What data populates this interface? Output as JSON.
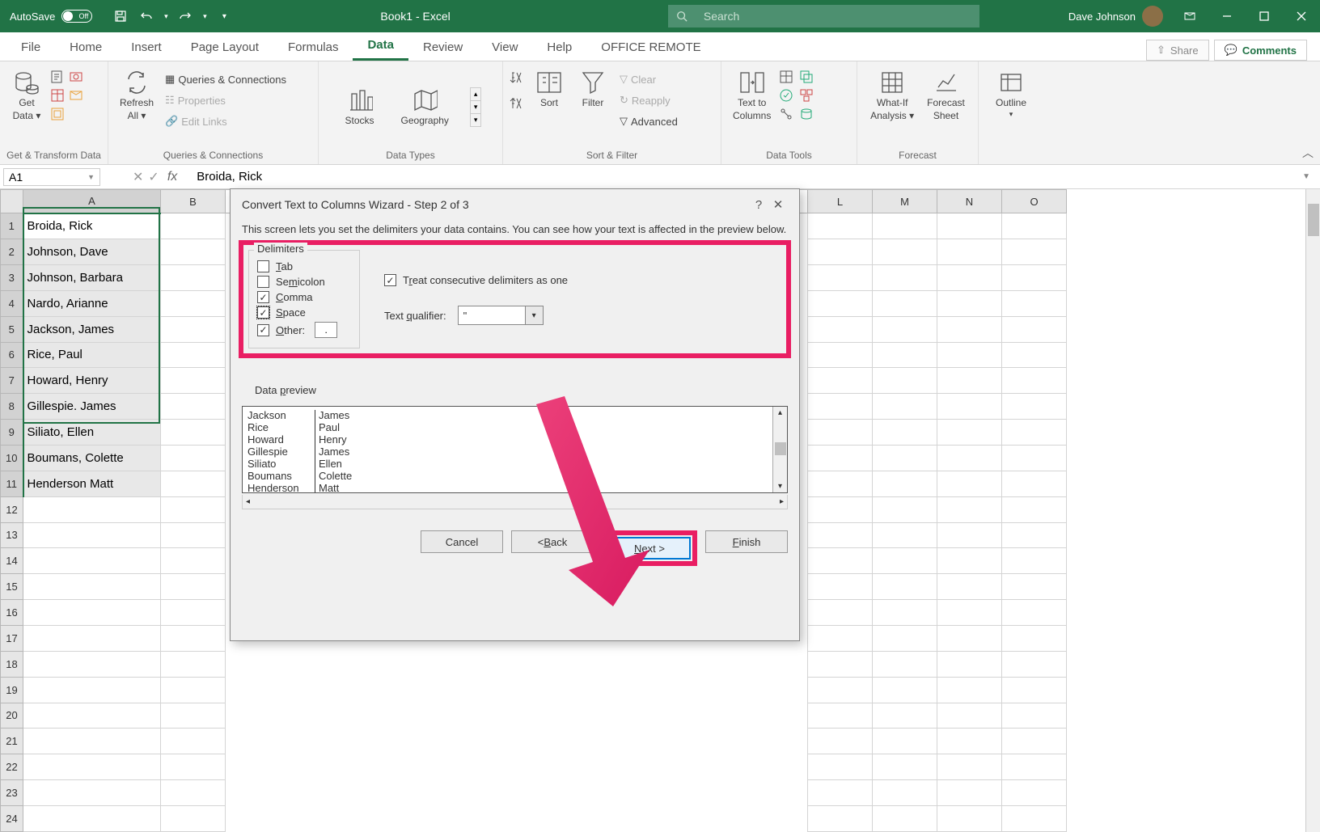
{
  "titlebar": {
    "autosave_label": "AutoSave",
    "autosave_state": "Off",
    "title": "Book1  -  Excel",
    "search_placeholder": "Search",
    "user_name": "Dave Johnson"
  },
  "tabs": {
    "file": "File",
    "home": "Home",
    "insert": "Insert",
    "page_layout": "Page Layout",
    "formulas": "Formulas",
    "data": "Data",
    "review": "Review",
    "view": "View",
    "help": "Help",
    "office_remote": "OFFICE REMOTE",
    "share": "Share",
    "comments": "Comments"
  },
  "ribbon": {
    "get_data": "Get",
    "get_data2": "Data",
    "group_get": "Get & Transform Data",
    "refresh_all": "Refresh",
    "refresh_all2": "All",
    "queries_conn": "Queries & Connections",
    "properties": "Properties",
    "edit_links": "Edit Links",
    "group_queries": "Queries & Connections",
    "stocks": "Stocks",
    "geography": "Geography",
    "group_datatypes": "Data Types",
    "sort": "Sort",
    "filter": "Filter",
    "clear": "Clear",
    "reapply": "Reapply",
    "advanced": "Advanced",
    "group_sortfilter": "Sort & Filter",
    "text_to_columns": "Text to",
    "text_to_columns2": "Columns",
    "group_datatools": "Data Tools",
    "whatif": "What-If",
    "whatif2": "Analysis",
    "forecast": "Forecast",
    "forecast2": "Sheet",
    "group_forecast": "Forecast",
    "outline": "Outline"
  },
  "formula_bar": {
    "name_box": "A1",
    "formula": "Broida, Rick"
  },
  "columns": [
    "A",
    "B",
    "L",
    "M",
    "N",
    "O"
  ],
  "cells": [
    "Broida, Rick",
    "Johnson, Dave",
    "Johnson, Barbara",
    "Nardo, Arianne",
    "Jackson, James",
    "Rice, Paul",
    "Howard, Henry",
    "Gillespie. James",
    "Siliato, Ellen",
    "Boumans, Colette",
    "Henderson Matt"
  ],
  "dialog": {
    "title": "Convert Text to Columns Wizard - Step 2 of 3",
    "description": "This screen lets you set the delimiters your data contains.  You can see how your text is affected in the preview below.",
    "delimiters_legend": "Delimiters",
    "tab": "Tab",
    "semicolon": "Semicolon",
    "comma": "Comma",
    "space": "Space",
    "other": "Other:",
    "other_value": ".",
    "treat_consecutive": "Treat consecutive delimiters as one",
    "text_qualifier_label": "Text qualifier:",
    "text_qualifier_value": "\"",
    "preview_label": "Data preview",
    "preview_rows": [
      {
        "c1": "Jackson",
        "c2": "James"
      },
      {
        "c1": "Rice",
        "c2": "Paul"
      },
      {
        "c1": "Howard",
        "c2": "Henry"
      },
      {
        "c1": "Gillespie",
        "c2": "James"
      },
      {
        "c1": "Siliato",
        "c2": "Ellen"
      },
      {
        "c1": "Boumans",
        "c2": "Colette"
      },
      {
        "c1": "Henderson",
        "c2": "Matt"
      }
    ],
    "btn_cancel": "Cancel",
    "btn_back": "< Back",
    "btn_next": "Next >",
    "btn_finish": "Finish"
  }
}
